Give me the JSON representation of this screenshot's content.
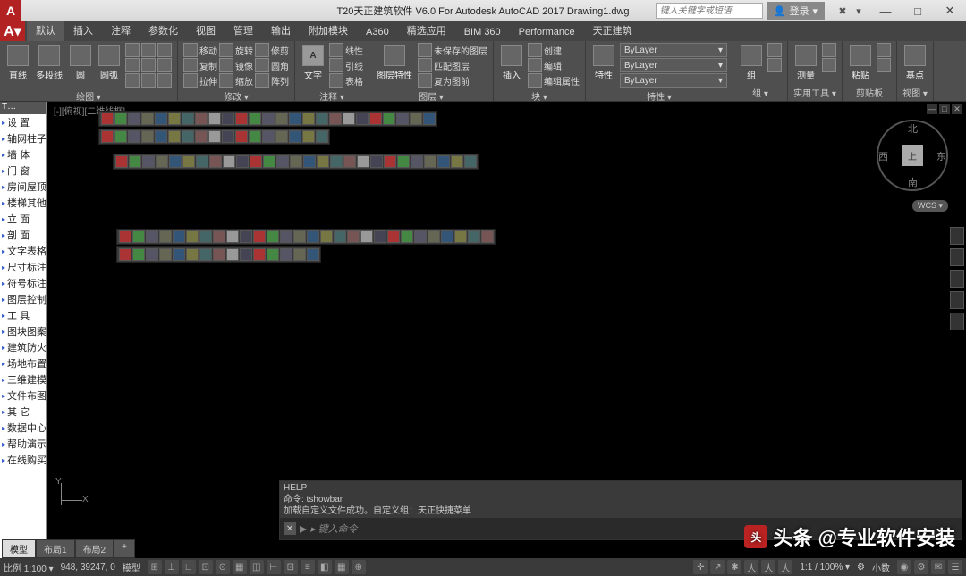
{
  "title": "T20天正建筑软件 V6.0 For Autodesk AutoCAD 2017    Drawing1.dwg",
  "search_placeholder": "键入关键字或短语",
  "login_label": "登录",
  "win": {
    "min": "—",
    "max": "□",
    "close": "✕"
  },
  "tabs": [
    "默认",
    "插入",
    "注释",
    "参数化",
    "视图",
    "管理",
    "输出",
    "附加模块",
    "A360",
    "精选应用",
    "BIM 360",
    "Performance",
    "天正建筑"
  ],
  "active_tab": 0,
  "panels": {
    "draw": {
      "label": "绘图 ▾",
      "items": [
        "直线",
        "多段线",
        "圆",
        "圆弧"
      ]
    },
    "modify": {
      "label": "修改 ▾",
      "rows": [
        [
          "移动",
          "旋转",
          "修剪"
        ],
        [
          "复制",
          "镜像",
          "圆角"
        ],
        [
          "拉伸",
          "缩放",
          "阵列"
        ]
      ]
    },
    "annot": {
      "label": "注释 ▾",
      "main": "文字",
      "rows": [
        "线性",
        "引线",
        "表格"
      ]
    },
    "layer": {
      "label": "图层 ▾",
      "main": "图层特性",
      "rows": [
        "未保存的图层",
        "匹配图层",
        "复为图前"
      ]
    },
    "block": {
      "label": "块 ▾",
      "main": "插入",
      "rows": [
        "创建",
        "编辑",
        "编辑属性"
      ]
    },
    "prop": {
      "label": "特性 ▾",
      "main": "特性",
      "layer_combos": [
        "ByLayer",
        "ByLayer",
        "ByLayer"
      ]
    },
    "group": {
      "label": "组 ▾",
      "main": "组"
    },
    "util": {
      "label": "实用工具 ▾",
      "main": "测量"
    },
    "clip": {
      "label": "剪贴板",
      "main": "粘贴"
    },
    "view": {
      "label": "视图 ▾",
      "main": "基点"
    }
  },
  "left_panel_title": "T…",
  "left_items": [
    "设   置",
    "轴网柱子",
    "墙    体",
    "门    窗",
    "房间屋顶",
    "楼梯其他",
    "立    面",
    "剖    面",
    "文字表格",
    "尺寸标注",
    "符号标注",
    "图层控制",
    "工    具",
    "图块图案",
    "建筑防火",
    "场地布置",
    "三维建模",
    "文件布图",
    "其    它",
    "数据中心",
    "帮助演示",
    "在线购买"
  ],
  "viewport_label": "[-][俯视][二维线框]",
  "viewcube": {
    "top": "上",
    "n": "北",
    "s": "南",
    "e": "东",
    "w": "西",
    "wcs": "WCS ▾"
  },
  "cmd_history": [
    "HELP",
    "命令: tshowbar",
    "加载自定义文件成功。自定义组：天正快捷菜单"
  ],
  "cmd_prompt": "▸ 键入命令",
  "model_tabs": [
    "模型",
    "布局1",
    "布局2",
    "+"
  ],
  "status": {
    "scale": "比例 1:100 ▾",
    "coords": "948, 39247, 0",
    "mode": "模型",
    "ratio": "1:1 / 100% ▾",
    "precision": "小数",
    "icons_left": [
      "⊞",
      "⊥",
      "∟",
      "⊡",
      "⊙",
      "▦",
      "◫",
      "⊢",
      "⊡",
      "≡",
      "◧",
      "▦",
      "⊕"
    ],
    "icons_right": [
      "✛",
      "↗",
      "✱",
      "人",
      "人",
      "人"
    ],
    "icons_far": [
      "◉",
      "⚙",
      "✉",
      "☰"
    ]
  },
  "watermark": "头条 @专业软件安装",
  "ucs": {
    "x": "X",
    "y": "Y"
  }
}
